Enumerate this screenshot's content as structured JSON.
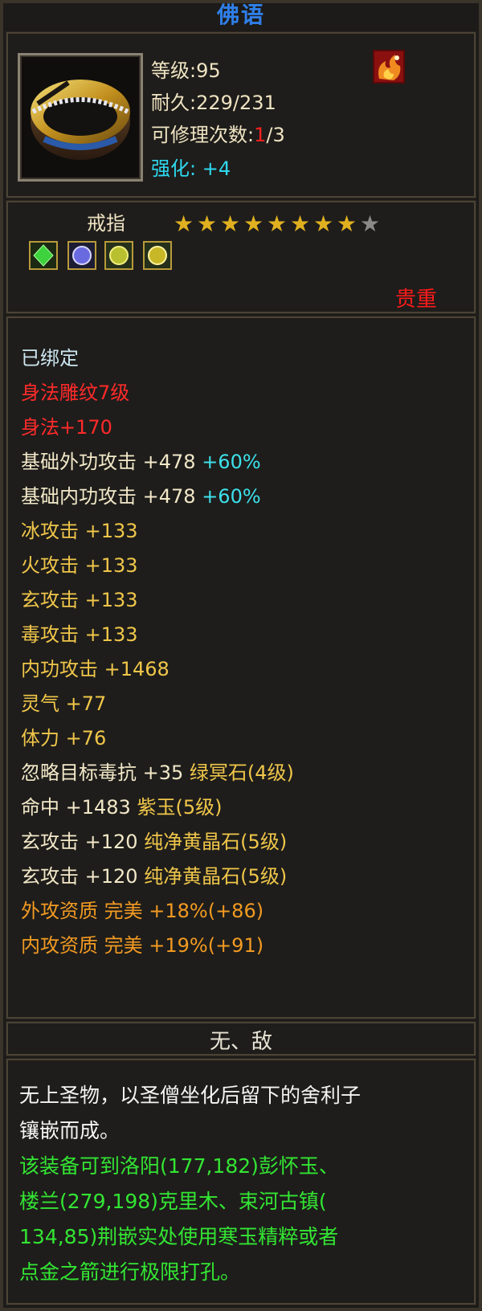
{
  "item": {
    "title": "佛语",
    "level_label": "等级",
    "level_sep": ":",
    "level_value": "95",
    "durability_label": "耐久",
    "durability_sep": ":",
    "durability_value": "229/231",
    "repair_label": "可修理次数",
    "repair_sep": ":",
    "repair_used": "1",
    "repair_total": "/3",
    "enhance_label": "强化",
    "enhance_sep": ":",
    "enhance_value": "+4",
    "type": "戒指",
    "stars_filled": 8,
    "stars_total": 9,
    "rarity": "贵重"
  },
  "attributes": [
    {
      "text": "已绑定",
      "color": "#cde6f0"
    },
    {
      "text": "身法雕纹7级",
      "color": "#ff2a2a"
    },
    {
      "text": "身法+170",
      "color": "#ff2a2a"
    },
    {
      "parts": [
        {
          "text": "基础外功攻击 +478 ",
          "color": "#f2e8c8"
        },
        {
          "text": "+60%",
          "color": "#3de0ea"
        }
      ]
    },
    {
      "parts": [
        {
          "text": "基础内功攻击 +478 ",
          "color": "#f2e8c8"
        },
        {
          "text": "+60%",
          "color": "#3de0ea"
        }
      ]
    },
    {
      "text": "冰攻击 +133",
      "color": "#f0c64a"
    },
    {
      "text": "火攻击 +133",
      "color": "#f0c64a"
    },
    {
      "text": "玄攻击 +133",
      "color": "#f0c64a"
    },
    {
      "text": "毒攻击 +133",
      "color": "#f0c64a"
    },
    {
      "text": "内功攻击 +1468",
      "color": "#f0c64a"
    },
    {
      "text": "灵气 +77",
      "color": "#f0c64a"
    },
    {
      "text": "体力 +76",
      "color": "#f0c64a"
    },
    {
      "parts": [
        {
          "text": "忽略目标毒抗 +35 ",
          "color": "#f2e8c8"
        },
        {
          "text": "绿冥石(4级)",
          "color": "#f0c64a"
        }
      ]
    },
    {
      "parts": [
        {
          "text": "命中 +1483 ",
          "color": "#f2e8c8"
        },
        {
          "text": "紫玉(5级)",
          "color": "#f0c64a"
        }
      ]
    },
    {
      "parts": [
        {
          "text": "玄攻击 +120 ",
          "color": "#f2e8c8"
        },
        {
          "text": "纯净黄晶石(5级)",
          "color": "#f0c64a"
        }
      ]
    },
    {
      "parts": [
        {
          "text": "玄攻击 +120 ",
          "color": "#f2e8c8"
        },
        {
          "text": "纯净黄晶石(5级)",
          "color": "#f0c64a"
        }
      ]
    },
    {
      "text": "外攻资质  完美 +18%(+86)",
      "color": "#f29a22"
    },
    {
      "text": "内攻资质  完美 +19%(+91)",
      "color": "#f29a22"
    }
  ],
  "set_name": "无、敌",
  "description": {
    "lines": [
      {
        "text": "无上圣物，以圣僧坐化后留下的舍利子",
        "color": "#f4f4f4"
      },
      {
        "text": "镶嵌而成。",
        "color": "#f4f4f4"
      },
      {
        "text": "该装备可到洛阳(177,182)彭怀玉、",
        "color": "#33e533"
      },
      {
        "text": "楼兰(279,198)克里木、束河古镇(",
        "color": "#33e533"
      },
      {
        "text": "134,85)荆嵌实处使用寒玉精粹或者",
        "color": "#33e533"
      },
      {
        "text": "点金之箭进行极限打孔。",
        "color": "#33e533"
      }
    ]
  },
  "colors": {
    "title": "#2f7fe8",
    "stat_text": "#efe3c2",
    "enhance": "#2fd8ef",
    "repair_used": "#ff2020",
    "rarity": "#ff1a1a",
    "star_filled": "#e0b020",
    "star_empty": "#8a8a8a",
    "set_name": "#e8e4d6"
  },
  "gems": [
    "green-gem-icon",
    "purple-gem-icon",
    "yellow-gem-icon",
    "yellow-gem-icon"
  ]
}
